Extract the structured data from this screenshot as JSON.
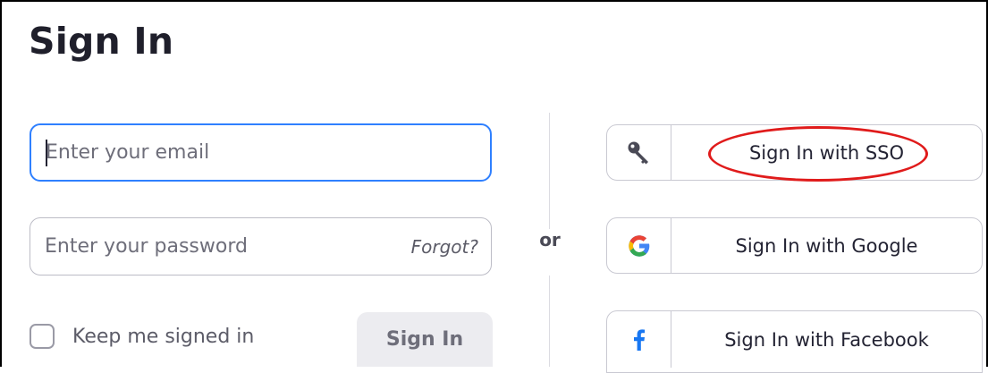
{
  "page": {
    "title": "Sign In"
  },
  "form": {
    "email": {
      "placeholder": "Enter your email",
      "value": ""
    },
    "password": {
      "placeholder": "Enter your password",
      "value": ""
    },
    "forgot_label": "Forgot?",
    "keep_signed_in_label": "Keep me signed in",
    "keep_signed_in_checked": false,
    "signin_label": "Sign In"
  },
  "divider": {
    "or_label": "or"
  },
  "alt_signin": [
    {
      "label": "Sign In with SSO",
      "icon": "key-icon"
    },
    {
      "label": "Sign In with Google",
      "icon": "google-icon"
    },
    {
      "label": "Sign In with Facebook",
      "icon": "facebook-icon"
    }
  ],
  "colors": {
    "focus_border": "#2f80ff",
    "highlight_circle": "#e01b1b",
    "disabled_button_bg": "#ececf0",
    "facebook_blue": "#1877f2"
  }
}
